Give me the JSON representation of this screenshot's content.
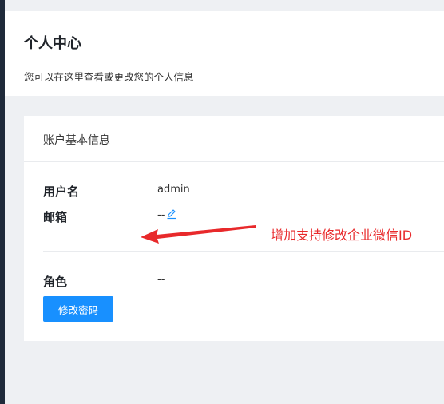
{
  "page": {
    "title": "个人中心",
    "subtitle": "您可以在这里查看或更改您的个人信息"
  },
  "card": {
    "title": "账户基本信息",
    "fields": [
      {
        "label": "用户名",
        "value": "admin"
      },
      {
        "label": "邮箱",
        "value": "--"
      },
      {
        "label": "角色",
        "value": "--"
      }
    ],
    "change_password_label": "修改密码"
  },
  "annotation": {
    "text": "增加支持修改企业微信ID",
    "color": "#e8292b"
  },
  "colors": {
    "primary": "#1890ff",
    "sidebar": "#1f2a3a",
    "background": "#eef0f3"
  },
  "icons": {
    "email_edit": "edit-icon"
  }
}
